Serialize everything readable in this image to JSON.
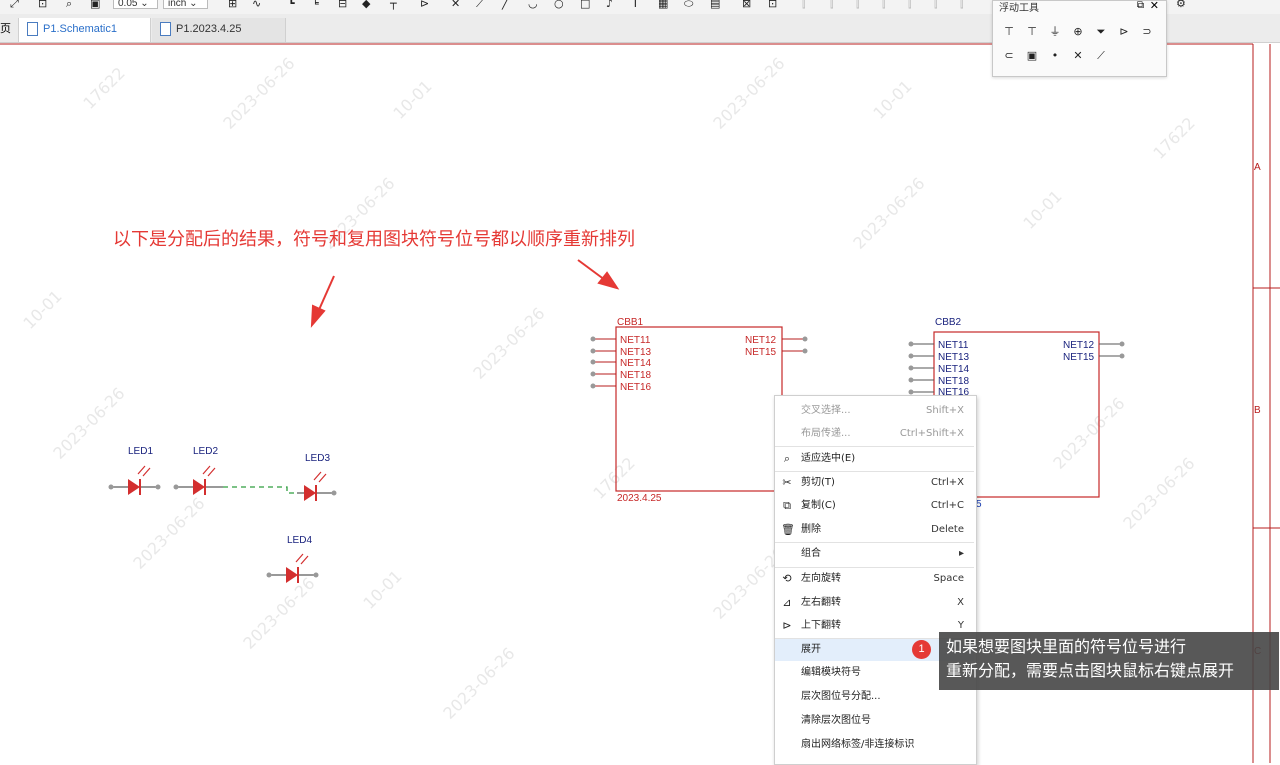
{
  "toolbar": {
    "grid_value": "0.05",
    "unit_value": "inch"
  },
  "tabs": [
    {
      "label": "页"
    },
    {
      "label": "P1.Schematic1"
    },
    {
      "label": "P1.2023.4.25"
    }
  ],
  "floating_panel": {
    "title": "浮动工具",
    "row1": [
      "vcc-icon",
      "power-port-icon",
      "ground-icon",
      "circle-plus-icon",
      "ground-arrow-icon",
      "net-port-out-icon",
      "net-port-icon"
    ],
    "row2": [
      "net-port-in-icon",
      "net-label-icon",
      "pin-dot-icon",
      "no-connect-icon",
      "probe-icon"
    ]
  },
  "annotation": "以下是分配后的结果，符号和复用图块符号位号都以顺序重新排列",
  "leds": [
    {
      "label": "LED1"
    },
    {
      "label": "LED2"
    },
    {
      "label": "LED3"
    },
    {
      "label": "LED4"
    }
  ],
  "cbb1": {
    "title": "CBB1",
    "left_nets": [
      "NET11",
      "NET13",
      "NET14",
      "NET18",
      "NET16"
    ],
    "right_nets": [
      "NET12",
      "NET15"
    ],
    "footer": "2023.4.25"
  },
  "cbb2": {
    "title": "CBB2",
    "left_nets": [
      "NET11",
      "NET13",
      "NET14",
      "NET18",
      "NET16"
    ],
    "right_nets": [
      "NET12",
      "NET15"
    ],
    "footer_fragment": "5"
  },
  "frame_markers": [
    "A",
    "B",
    "C"
  ],
  "watermarks": [
    "17622",
    "2023-06-26",
    "10-01"
  ],
  "context_menu": [
    {
      "label": "交叉选择...",
      "shortcut": "Shift+X",
      "disabled": true
    },
    {
      "label": "布局传递...",
      "shortcut": "Ctrl+Shift+X",
      "disabled": true
    },
    {
      "label": "适应选中(E)",
      "shortcut": ""
    },
    {
      "label": "剪切(T)",
      "shortcut": "Ctrl+X"
    },
    {
      "label": "复制(C)",
      "shortcut": "Ctrl+C"
    },
    {
      "label": "删除",
      "shortcut": "Delete"
    },
    {
      "label": "组合",
      "shortcut": "▸"
    },
    {
      "label": "左向旋转",
      "shortcut": "Space"
    },
    {
      "label": "左右翻转",
      "shortcut": "X"
    },
    {
      "label": "上下翻转",
      "shortcut": "Y"
    },
    {
      "label": "展开",
      "shortcut": ""
    },
    {
      "label": "编辑模块符号",
      "shortcut": ""
    },
    {
      "label": "层次图位号分配...",
      "shortcut": ""
    },
    {
      "label": "清除层次图位号",
      "shortcut": ""
    },
    {
      "label": "扇出网络标签/非连接标识",
      "shortcut": ""
    }
  ],
  "callout": {
    "badge": "1",
    "line1": "如果想要图块里面的符号位号进行",
    "line2": "重新分配，需要点击图块鼠标右键点展开"
  }
}
